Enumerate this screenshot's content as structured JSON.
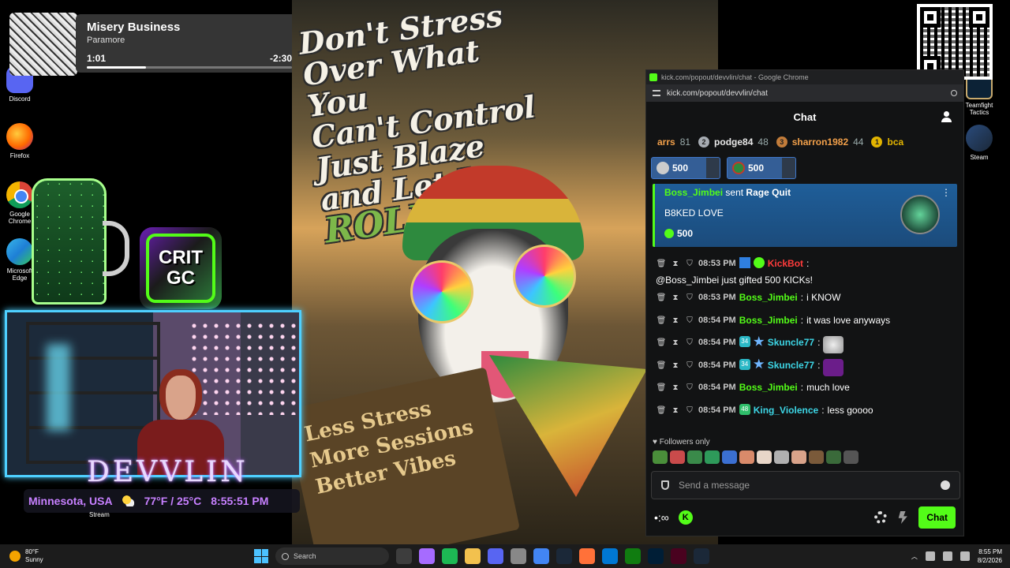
{
  "desktop_icons": [
    {
      "label": "Discord"
    },
    {
      "label": "Firefox"
    },
    {
      "label": "Google Chrome"
    },
    {
      "label": "Microsoft Edge"
    },
    {
      "label": "Teamfight Tactics"
    },
    {
      "label": "Steam"
    }
  ],
  "now_playing": {
    "title": "Misery Business",
    "artist": "Paramore",
    "elapsed": "1:01",
    "remaining": "-2:30",
    "progress": 0.29
  },
  "poster": {
    "headline": [
      "Don't Stress",
      "Over What You",
      "Can't Control",
      "Just Blaze",
      "and Let It"
    ],
    "headline_emphasis": "ROLL",
    "sign": [
      "Less Stress",
      "More Sessions",
      "Better Vibes"
    ]
  },
  "overlay": {
    "crit_logo": [
      "CRIT",
      "GC"
    ],
    "streamer_name": "DEVVLIN",
    "location": "Minnesota, USA",
    "weather": "77°F / 25°C",
    "time": "8:55:51 PM",
    "stream_label": "Stream"
  },
  "browser": {
    "window_title": "kick.com/popout/devvlin/chat - Google Chrome",
    "url": "kick.com/popout/devvlin/chat"
  },
  "chat": {
    "title": "Chat",
    "leaderboard": [
      {
        "name": "arrs",
        "count": "81",
        "rank": "",
        "color": "orange"
      },
      {
        "name": "podge84",
        "count": "48",
        "rank": "2",
        "color": "silver"
      },
      {
        "name": "sharron1982",
        "count": "44",
        "rank": "3",
        "color": "orange"
      },
      {
        "name": "bca",
        "count": "",
        "rank": "1",
        "color": "gold"
      }
    ],
    "pinned_gifts": [
      {
        "amount": "500",
        "progress": 0.8
      },
      {
        "amount": "500",
        "progress": 0.8
      }
    ],
    "gift_event": {
      "sender": "Boss_Jimbei",
      "action": "sent",
      "item": "Rage Quit",
      "message": "B8KED LOVE",
      "amount": "500"
    },
    "messages": [
      {
        "time": "08:53 PM",
        "user": "KickBot",
        "color": "red",
        "text": "@Boss_Jimbei just gifted 500 KICKs!",
        "badges": [
          "bot",
          "verified"
        ],
        "emote": ""
      },
      {
        "time": "08:53 PM",
        "user": "Boss_Jimbei",
        "color": "green",
        "text": "i KNOW",
        "badges": [],
        "emote": ""
      },
      {
        "time": "08:54 PM",
        "user": "Boss_Jimbei",
        "color": "green",
        "text": "it was love anyways",
        "badges": [],
        "emote": ""
      },
      {
        "time": "08:54 PM",
        "user": "Skuncle77",
        "color": "cyan",
        "text": "",
        "badges": [
          "34",
          "star"
        ],
        "emote": "e1"
      },
      {
        "time": "08:54 PM",
        "user": "Skuncle77",
        "color": "cyan",
        "text": "",
        "badges": [
          "34",
          "star"
        ],
        "emote": "e2"
      },
      {
        "time": "08:54 PM",
        "user": "Boss_Jimbei",
        "color": "green",
        "text": "much love",
        "badges": [],
        "emote": ""
      },
      {
        "time": "08:54 PM",
        "user": "King_Violence",
        "color": "cyan",
        "text": "less goooo",
        "badges": [
          "48"
        ],
        "emote": ""
      }
    ],
    "followers_only": "Followers only",
    "input_placeholder": "Send a message",
    "send_label": "Chat",
    "emote_colors": [
      "#4a8f3a",
      "#c94b4b",
      "#3a8a4a",
      "#2e9a5a",
      "#3b6fd1",
      "#d98a6a",
      "#e8d6c8",
      "#b0b0b0",
      "#d9a38a",
      "#7a5a3a",
      "#3a6a3a",
      "#555555"
    ]
  },
  "taskbar": {
    "temperature": "80°F",
    "condition": "Sunny",
    "search_placeholder": "Search",
    "time": "8:55 PM",
    "date": "8/2/2026",
    "apps": [
      "#3d3d3d",
      "#a66bff",
      "#1db954",
      "#f2c14e",
      "#5865f2",
      "#888888",
      "#4285f4",
      "#1b2838",
      "#ff7139",
      "#0078d4",
      "#107c10",
      "#001e36",
      "#49021f",
      "#1b2838"
    ]
  }
}
